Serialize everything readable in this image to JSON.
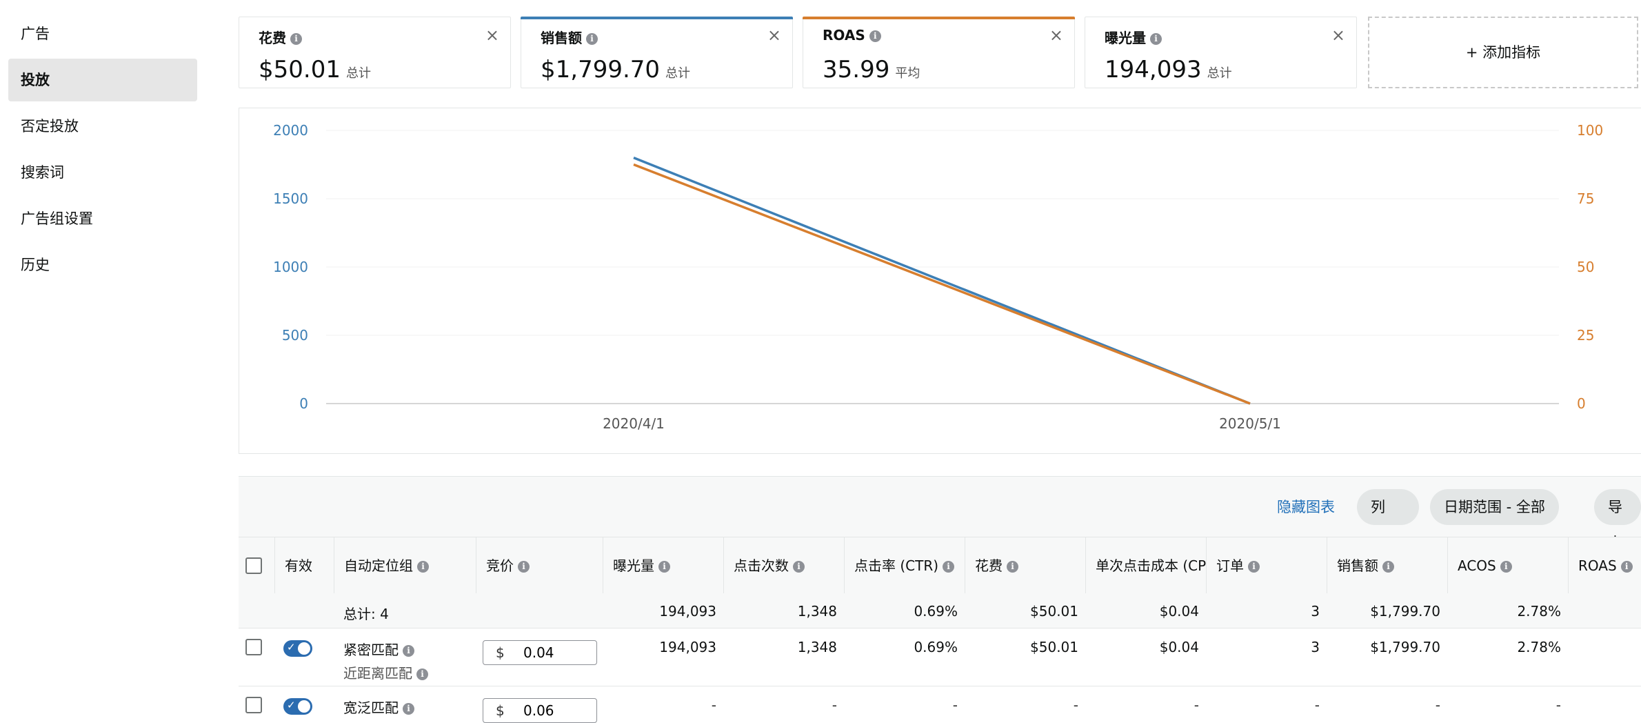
{
  "sidebar": {
    "items": [
      {
        "label": "广告",
        "active": false
      },
      {
        "label": "投放",
        "active": true
      },
      {
        "label": "否定投放",
        "active": false
      },
      {
        "label": "搜索词",
        "active": false
      },
      {
        "label": "广告组设置",
        "active": false
      },
      {
        "label": "历史",
        "active": false
      }
    ]
  },
  "metrics": [
    {
      "name": "花费",
      "value": "$50.01",
      "sub": "总计",
      "accent": null
    },
    {
      "name": "销售额",
      "value": "$1,799.70",
      "sub": "总计",
      "accent": "#3d7fb5"
    },
    {
      "name": "ROAS",
      "value": "35.99",
      "sub": "平均",
      "accent": "#d77e2e"
    },
    {
      "name": "曝光量",
      "value": "194,093",
      "sub": "总计",
      "accent": null
    }
  ],
  "add_metric": "+ 添加指标",
  "chart_data": {
    "type": "line",
    "x": [
      "2020/4/1",
      "2020/5/1"
    ],
    "y_left": {
      "ticks": [
        "0",
        "500",
        "1000",
        "1500",
        "2000"
      ],
      "range": [
        0,
        2000
      ],
      "color": "#3d7fb5"
    },
    "y_right": {
      "ticks": [
        "0",
        "25",
        "50",
        "75",
        "100"
      ],
      "range": [
        0,
        100
      ],
      "color": "#d77e2e"
    },
    "series": [
      {
        "axis": "left",
        "values": [
          1799.7,
          0
        ],
        "color": "#3d7fb5"
      },
      {
        "axis": "right",
        "values": [
          87.5,
          0
        ],
        "color": "#d77e2e"
      }
    ]
  },
  "toolbar": {
    "hide_chart": "隐藏图表",
    "columns": "列",
    "date_range": "日期范围 - 全部",
    "export": "导出"
  },
  "table": {
    "headers": [
      "有效",
      "自动定位组",
      "竞价",
      "曝光量",
      "点击次数",
      "点击率 (CTR)",
      "花费",
      "单次点击成本 (CPC)",
      "订单",
      "销售额",
      "ACOS",
      "ROAS"
    ],
    "total": {
      "label": "总计: 4",
      "impressions": "194,093",
      "clicks": "1,348",
      "ctr": "0.69%",
      "spend": "$50.01",
      "cpc": "$0.04",
      "orders": "3",
      "sales": "$1,799.70",
      "acos": "2.78%"
    },
    "rows": [
      {
        "name": "紧密匹配",
        "sub": "近距离匹配",
        "bid_currency": "$",
        "bid": "0.04",
        "impressions": "194,093",
        "clicks": "1,348",
        "ctr": "0.69%",
        "spend": "$50.01",
        "cpc": "$0.04",
        "orders": "3",
        "sales": "$1,799.70",
        "acos": "2.78%"
      },
      {
        "name": "宽泛匹配",
        "sub": "",
        "bid_currency": "$",
        "bid": "0.06",
        "impressions": "-",
        "clicks": "-",
        "ctr": "-",
        "spend": "-",
        "cpc": "-",
        "orders": "-",
        "sales": "-",
        "acos": "-"
      }
    ]
  }
}
